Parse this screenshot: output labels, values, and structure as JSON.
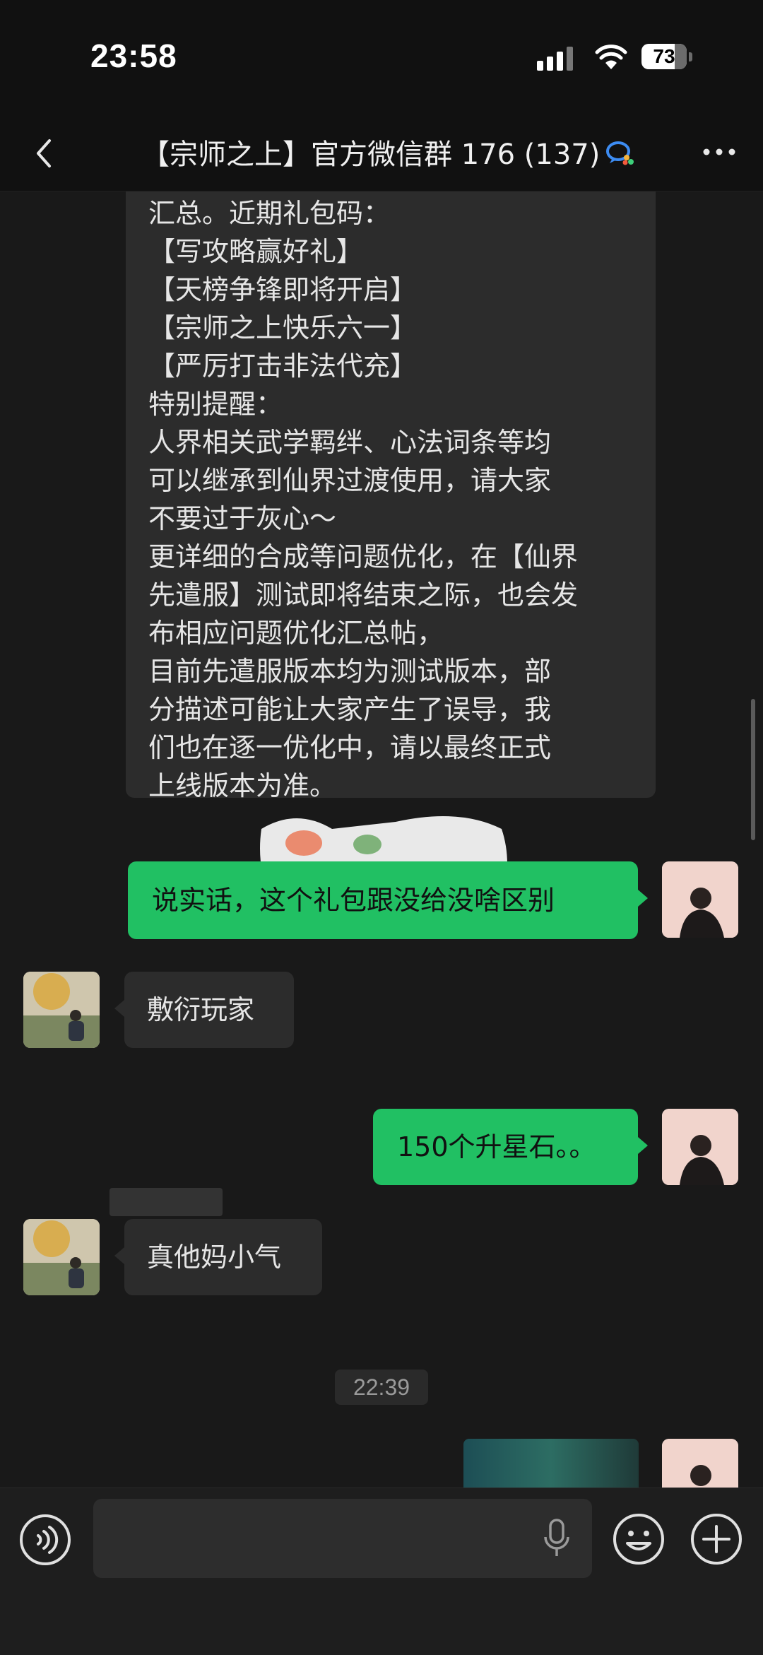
{
  "status_bar": {
    "time": "23:58",
    "battery": "73"
  },
  "header": {
    "title": "【宗师之上】官方微信群 176 (137)"
  },
  "messages": {
    "long_message_lines": [
      "汇总。近期礼包码：",
      "【写攻略赢好礼】",
      "【天榜争锋即将开启】",
      "【宗师之上快乐六一】",
      "【严厉打击非法代充】",
      "特别提醒：",
      "人界相关武学羁绊、心法词条等均",
      "可以继承到仙界过渡使用，请大家",
      "不要过于灰心～",
      "更详细的合成等问题优化，在【仙界",
      "先遣服】测试即将结束之际，也会发",
      "布相应问题优化汇总帖，",
      "目前先遣服版本均为测试版本，部",
      "分描述可能让大家产生了误导，我",
      "们也在逐一优化中，请以最终正式",
      "上线版本为准。"
    ],
    "msg_me_1": "说实话，这个礼包跟没给没啥区别",
    "msg_other_1": "敷衍玩家",
    "msg_me_2": "150个升星石。。",
    "msg_other_2": "真他妈小气",
    "timestamp": "22:39"
  },
  "colors": {
    "accent_green": "#21c063",
    "chat_bg": "#191919",
    "bubble_other": "#2c2c2c"
  },
  "icons": {
    "back": "chevron-left-icon",
    "wecom": "wecom-badge-icon",
    "more": "more-dots-icon",
    "voice": "voice-mode-icon",
    "mic": "mic-icon",
    "emoji": "emoji-icon",
    "plus": "plus-icon"
  }
}
